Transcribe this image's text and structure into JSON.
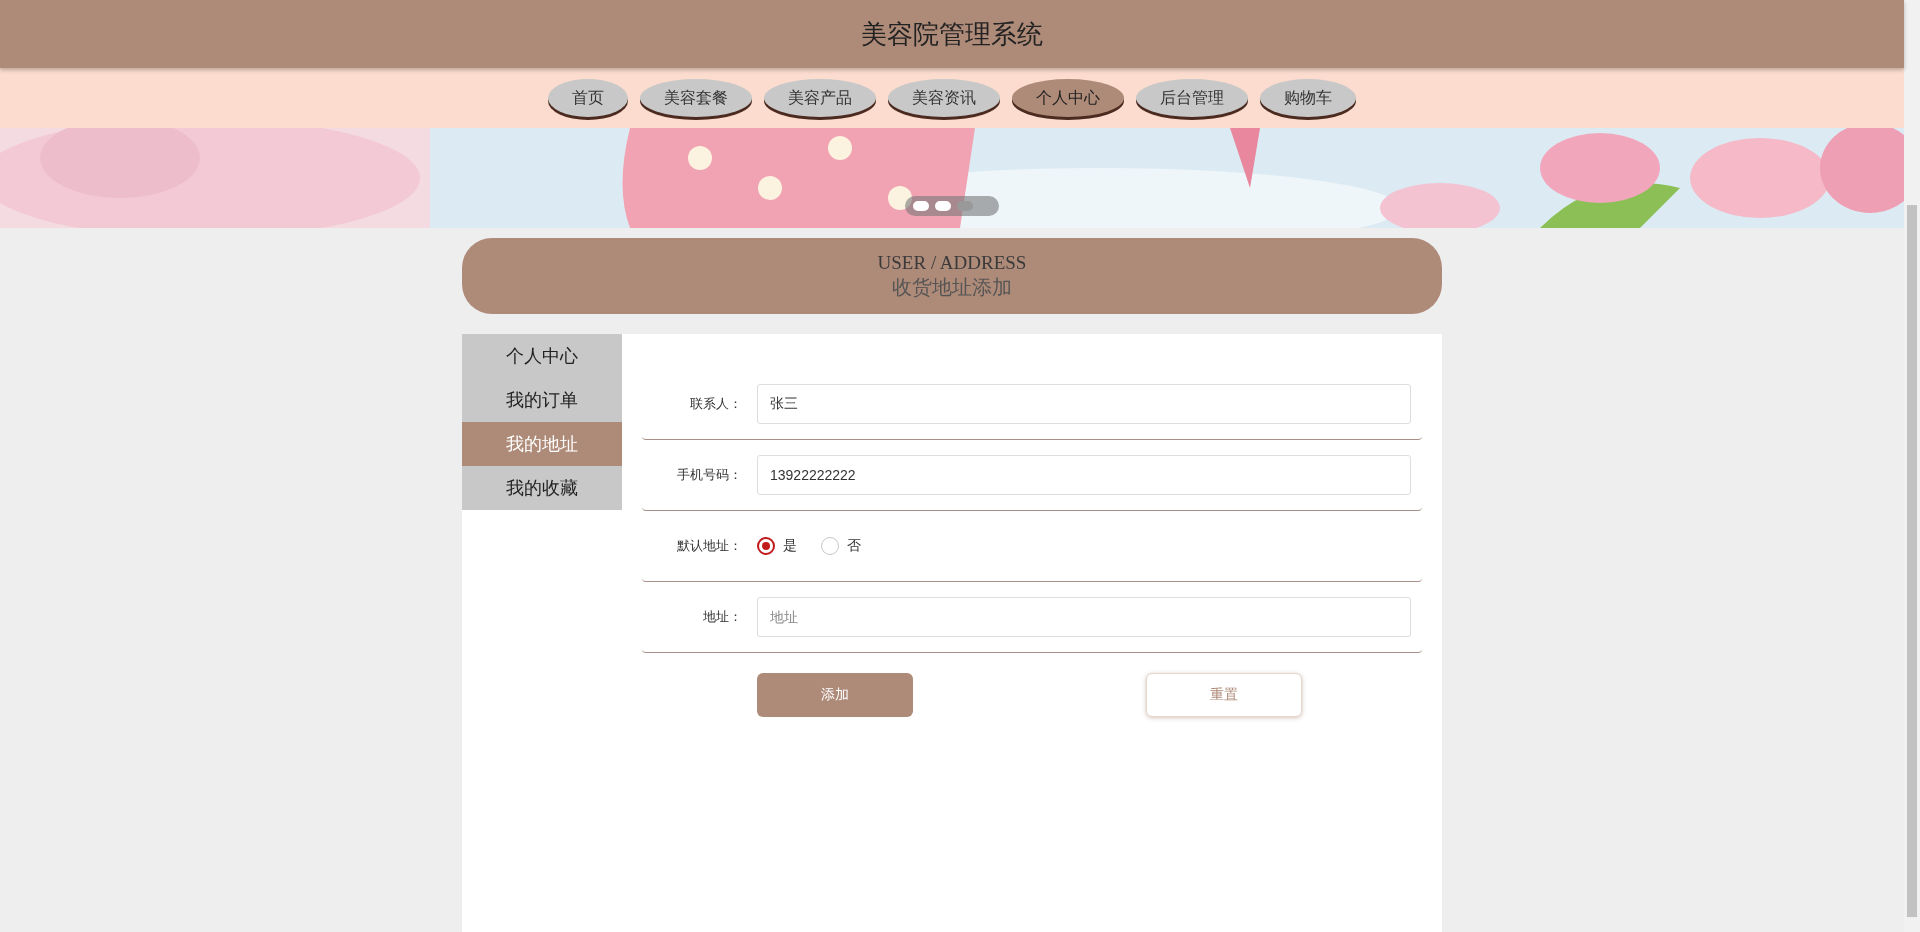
{
  "header": {
    "title": "美容院管理系统"
  },
  "nav": [
    {
      "label": "首页",
      "selected": false
    },
    {
      "label": "美容套餐",
      "selected": false
    },
    {
      "label": "美容产品",
      "selected": false
    },
    {
      "label": "美容资讯",
      "selected": false
    },
    {
      "label": "个人中心",
      "selected": true
    },
    {
      "label": "后台管理",
      "selected": false
    },
    {
      "label": "购物车",
      "selected": false
    }
  ],
  "banner": {
    "dots": [
      {
        "selected": true
      },
      {
        "selected": true
      },
      {
        "selected": false
      }
    ]
  },
  "page_title": {
    "subtitle": "USER / ADDRESS",
    "title": "收货地址添加"
  },
  "sidebar": {
    "items": [
      {
        "label": "个人中心",
        "selected": false
      },
      {
        "label": "我的订单",
        "selected": false
      },
      {
        "label": "我的地址",
        "selected": true
      },
      {
        "label": "我的收藏",
        "selected": false
      }
    ]
  },
  "form": {
    "fields": [
      {
        "kind": "text",
        "label": "联系人：",
        "value": "张三"
      },
      {
        "kind": "text",
        "label": "手机号码：",
        "value": "13922222222"
      },
      {
        "kind": "radio",
        "label": "默认地址：",
        "options": [
          {
            "label": "是",
            "selected": true
          },
          {
            "label": "否",
            "selected": false
          }
        ]
      },
      {
        "kind": "text",
        "label": "地址：",
        "placeholder": "地址"
      }
    ],
    "buttons": [
      {
        "label": "添加",
        "kind": "primary"
      },
      {
        "label": "重置",
        "kind": "secondary"
      }
    ]
  }
}
